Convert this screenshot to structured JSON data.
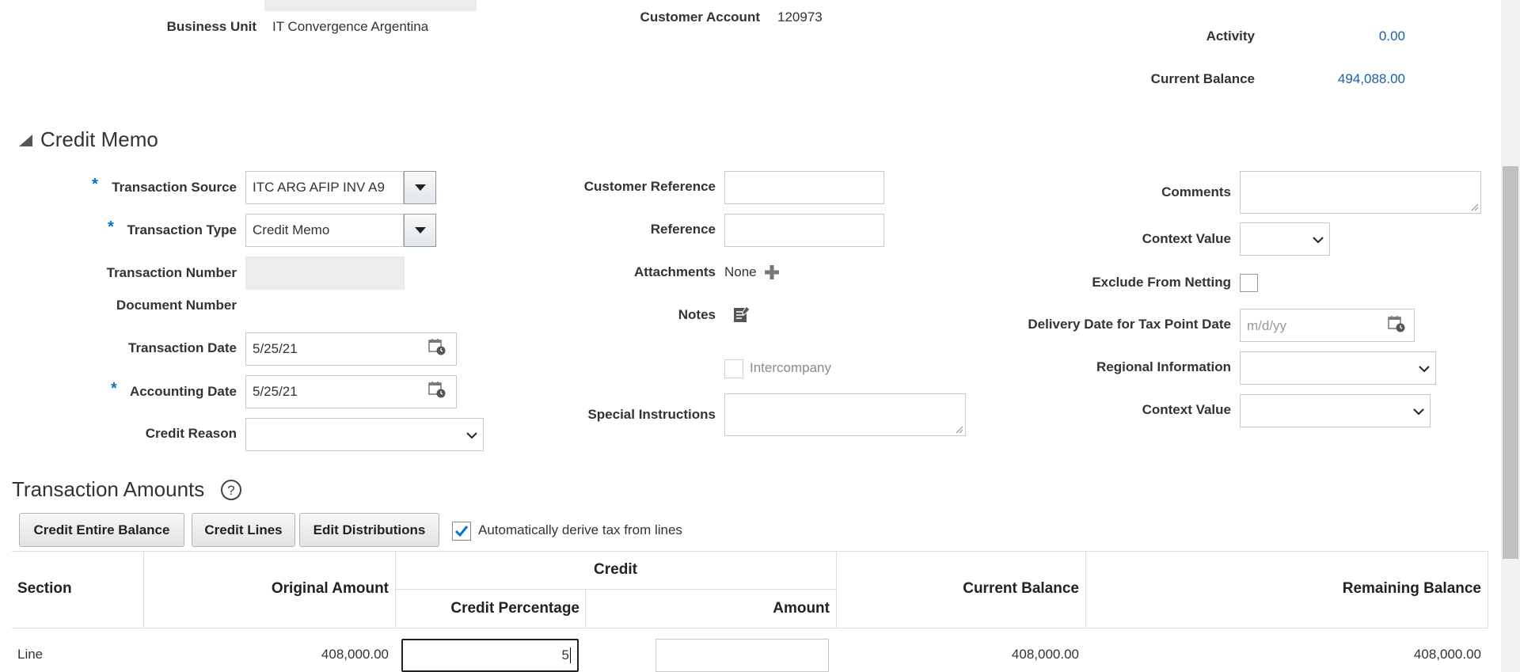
{
  "header": {
    "business_unit_label": "Business Unit",
    "business_unit_value": "IT Convergence Argentina",
    "customer_account_label": "Customer Account",
    "customer_account_value": "120973",
    "activity_label": "Activity",
    "activity_value": "0.00",
    "current_balance_label": "Current Balance",
    "current_balance_value": "494,088.00"
  },
  "credit_memo": {
    "title": "Credit Memo",
    "left": {
      "transaction_source_label": "Transaction Source",
      "transaction_source_value": "ITC ARG AFIP INV A9",
      "transaction_type_label": "Transaction Type",
      "transaction_type_value": "Credit Memo",
      "transaction_number_label": "Transaction Number",
      "document_number_label": "Document Number",
      "transaction_date_label": "Transaction Date",
      "transaction_date_value": "5/25/21",
      "accounting_date_label": "Accounting Date",
      "accounting_date_value": "5/25/21",
      "credit_reason_label": "Credit Reason"
    },
    "middle": {
      "customer_reference_label": "Customer Reference",
      "reference_label": "Reference",
      "attachments_label": "Attachments",
      "attachments_value": "None",
      "notes_label": "Notes",
      "intercompany_label": "Intercompany",
      "special_instructions_label": "Special Instructions"
    },
    "right": {
      "comments_label": "Comments",
      "context_value_label": "Context Value",
      "exclude_from_netting_label": "Exclude From Netting",
      "delivery_date_label": "Delivery Date for Tax Point Date",
      "delivery_date_placeholder": "m/d/yy",
      "regional_information_label": "Regional Information",
      "context_value_label_2": "Context Value"
    },
    "required_mark": "*"
  },
  "transaction_amounts": {
    "title": "Transaction Amounts",
    "buttons": {
      "credit_entire_balance": "Credit Entire Balance",
      "credit_lines": "Credit Lines",
      "edit_distributions": "Edit Distributions"
    },
    "auto_derive_label": "Automatically derive tax from lines",
    "auto_derive_checked": true,
    "table": {
      "headers": {
        "section": "Section",
        "original_amount": "Original Amount",
        "credit_group": "Credit",
        "credit_percentage": "Credit Percentage",
        "amount": "Amount",
        "current_balance": "Current Balance",
        "remaining_balance": "Remaining Balance"
      },
      "rows": [
        {
          "section": "Line",
          "original_amount": "408,000.00",
          "credit_percentage": "5",
          "amount": "",
          "current_balance": "408,000.00",
          "remaining_balance": "408,000.00"
        }
      ]
    }
  },
  "colors": {
    "link": "#1a5fa8",
    "required": "#0572ce",
    "checkbox_check": "#0572ce"
  }
}
